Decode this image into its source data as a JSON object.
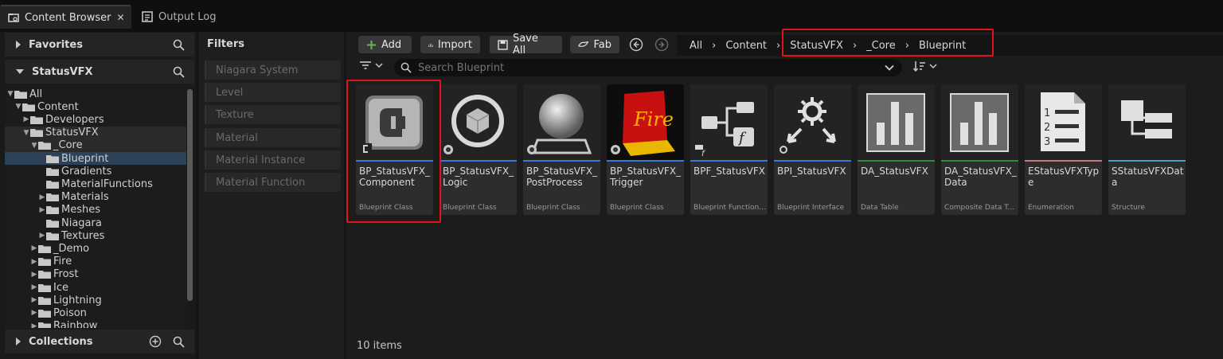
{
  "tabs": [
    {
      "label": "Content Browser",
      "close": "✕"
    },
    {
      "label": "Output Log"
    }
  ],
  "left": {
    "favorites_label": "Favorites",
    "root_label": "StatusVFX",
    "collections_label": "Collections",
    "tree": [
      {
        "label": "All",
        "indent": 0,
        "arrow": "▼"
      },
      {
        "label": "Content",
        "indent": 1,
        "arrow": "▼"
      },
      {
        "label": "Developers",
        "indent": 2,
        "arrow": "▶"
      },
      {
        "label": "StatusVFX",
        "indent": 2,
        "arrow": "▼"
      },
      {
        "label": "_Core",
        "indent": 3,
        "arrow": "▼"
      },
      {
        "label": "Blueprint",
        "indent": 4,
        "arrow": ""
      },
      {
        "label": "Gradients",
        "indent": 4,
        "arrow": ""
      },
      {
        "label": "MaterialFunctions",
        "indent": 4,
        "arrow": ""
      },
      {
        "label": "Materials",
        "indent": 4,
        "arrow": "▶"
      },
      {
        "label": "Meshes",
        "indent": 4,
        "arrow": "▶"
      },
      {
        "label": "Niagara",
        "indent": 4,
        "arrow": ""
      },
      {
        "label": "Textures",
        "indent": 4,
        "arrow": "▶"
      },
      {
        "label": "_Demo",
        "indent": 3,
        "arrow": "▶"
      },
      {
        "label": "Fire",
        "indent": 3,
        "arrow": "▶"
      },
      {
        "label": "Frost",
        "indent": 3,
        "arrow": "▶"
      },
      {
        "label": "Ice",
        "indent": 3,
        "arrow": "▶"
      },
      {
        "label": "Lightning",
        "indent": 3,
        "arrow": "▶"
      },
      {
        "label": "Poison",
        "indent": 3,
        "arrow": "▶"
      },
      {
        "label": "Rainbow",
        "indent": 3,
        "arrow": "▶"
      }
    ]
  },
  "filters": {
    "title": "Filters",
    "items": [
      "Niagara System",
      "Level",
      "Texture",
      "Material",
      "Material Instance",
      "Material Function"
    ]
  },
  "toolbar": {
    "add": "Add",
    "import": "Import",
    "save_all": "Save All",
    "fab": "Fab"
  },
  "breadcrumb": [
    "All",
    "Content",
    "StatusVFX",
    "_Core",
    "Blueprint"
  ],
  "breadcrumb_sep": "›",
  "search": {
    "placeholder": "Search Blueprint"
  },
  "assets": [
    {
      "name": "BP_StatusVFX_ Component",
      "type": "Blueprint Class",
      "color": "#3c78d8",
      "icon": "component-icon"
    },
    {
      "name": "BP_StatusVFX_ Logic",
      "type": "Blueprint Class",
      "color": "#3c78d8",
      "icon": "logic-cube-icon"
    },
    {
      "name": "BP_StatusVFX_ PostProcess",
      "type": "Blueprint Class",
      "color": "#3c78d8",
      "icon": "postprocess-sphere-icon"
    },
    {
      "name": "BP_StatusVFX_ Trigger",
      "type": "Blueprint Class",
      "color": "#3c78d8",
      "icon": "fire-trigger-icon"
    },
    {
      "name": "BPF_StatusVFX",
      "type": "Blueprint Function Library",
      "color": "#3c78d8",
      "icon": "function-library-icon"
    },
    {
      "name": "BPI_StatusVFX",
      "type": "Blueprint Interface",
      "color": "#3c78d8",
      "icon": "interface-gear-icon"
    },
    {
      "name": "DA_StatusVFX",
      "type": "Data Table",
      "color": "#2e8b3a",
      "icon": "data-table-icon"
    },
    {
      "name": "DA_StatusVFX_ Data",
      "type": "Composite Data Table",
      "color": "#2e8b3a",
      "icon": "composite-data-table-icon"
    },
    {
      "name": "EStatusVFXType",
      "type": "Enumeration",
      "color": "#c07a7a",
      "icon": "enumeration-list-icon"
    },
    {
      "name": "SStatusVFXData",
      "type": "Structure",
      "color": "#4aa0b8",
      "icon": "structure-icon"
    }
  ],
  "item_count": "10 items"
}
